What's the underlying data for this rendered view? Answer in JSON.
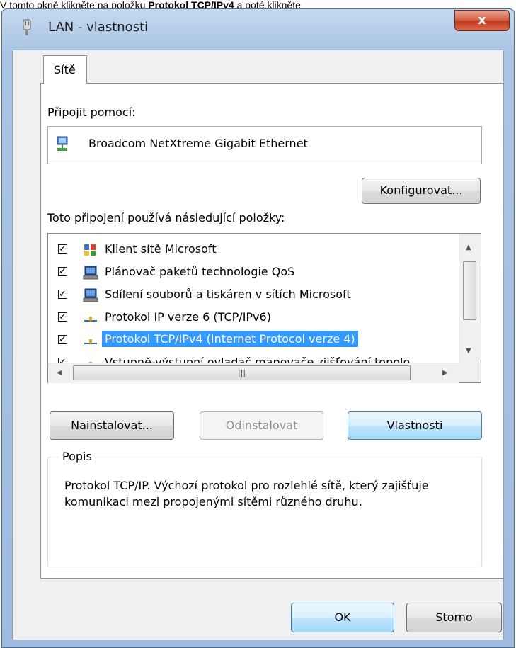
{
  "caption": {
    "prefix": "V tomto okně klikněte na položku ",
    "bold": "Protokol TCP/IPv4",
    "suffix": " a poté klikněte"
  },
  "window": {
    "title": "LAN - vlastnosti",
    "close_label": "x"
  },
  "tabs": [
    {
      "label": "Sítě"
    }
  ],
  "connect": {
    "label": "Připojit pomocí:",
    "adapter": "Broadcom NetXtreme Gigabit Ethernet",
    "configure_button": "Konfigurovat..."
  },
  "items": {
    "label": "Toto připojení používá následující položky:",
    "list": [
      {
        "label": "Klient sítě Microsoft",
        "checked": true,
        "icon": "network-client-icon"
      },
      {
        "label": "Plánovač paketů technologie QoS",
        "checked": true,
        "icon": "computer-service-icon"
      },
      {
        "label": "Sdílení souborů a tiskáren v sítích Microsoft",
        "checked": true,
        "icon": "computer-service-icon"
      },
      {
        "label": "Protokol IP verze 6 (TCP/IPv6)",
        "checked": true,
        "icon": "protocol-icon"
      },
      {
        "label": "Protokol TCP/IPv4 (Internet Protocol verze 4)",
        "checked": true,
        "icon": "protocol-icon",
        "selected": true
      },
      {
        "label": "Vstupně-výstupní ovladač mapovače zjišťování topolo",
        "checked": true,
        "icon": "protocol-icon"
      }
    ]
  },
  "buttons": {
    "install": "Nainstalovat...",
    "uninstall": "Odinstalovat",
    "properties": "Vlastnosti",
    "ok": "OK",
    "cancel": "Storno"
  },
  "description": {
    "title": "Popis",
    "text": "Protokol TCP/IP. Výchozí protokol pro rozlehlé sítě, který zajišťuje komunikaci mezi propojenými sítěmi různého druhu."
  },
  "colors": {
    "selection": "#3399ff",
    "close_button": "#c13a1e"
  }
}
